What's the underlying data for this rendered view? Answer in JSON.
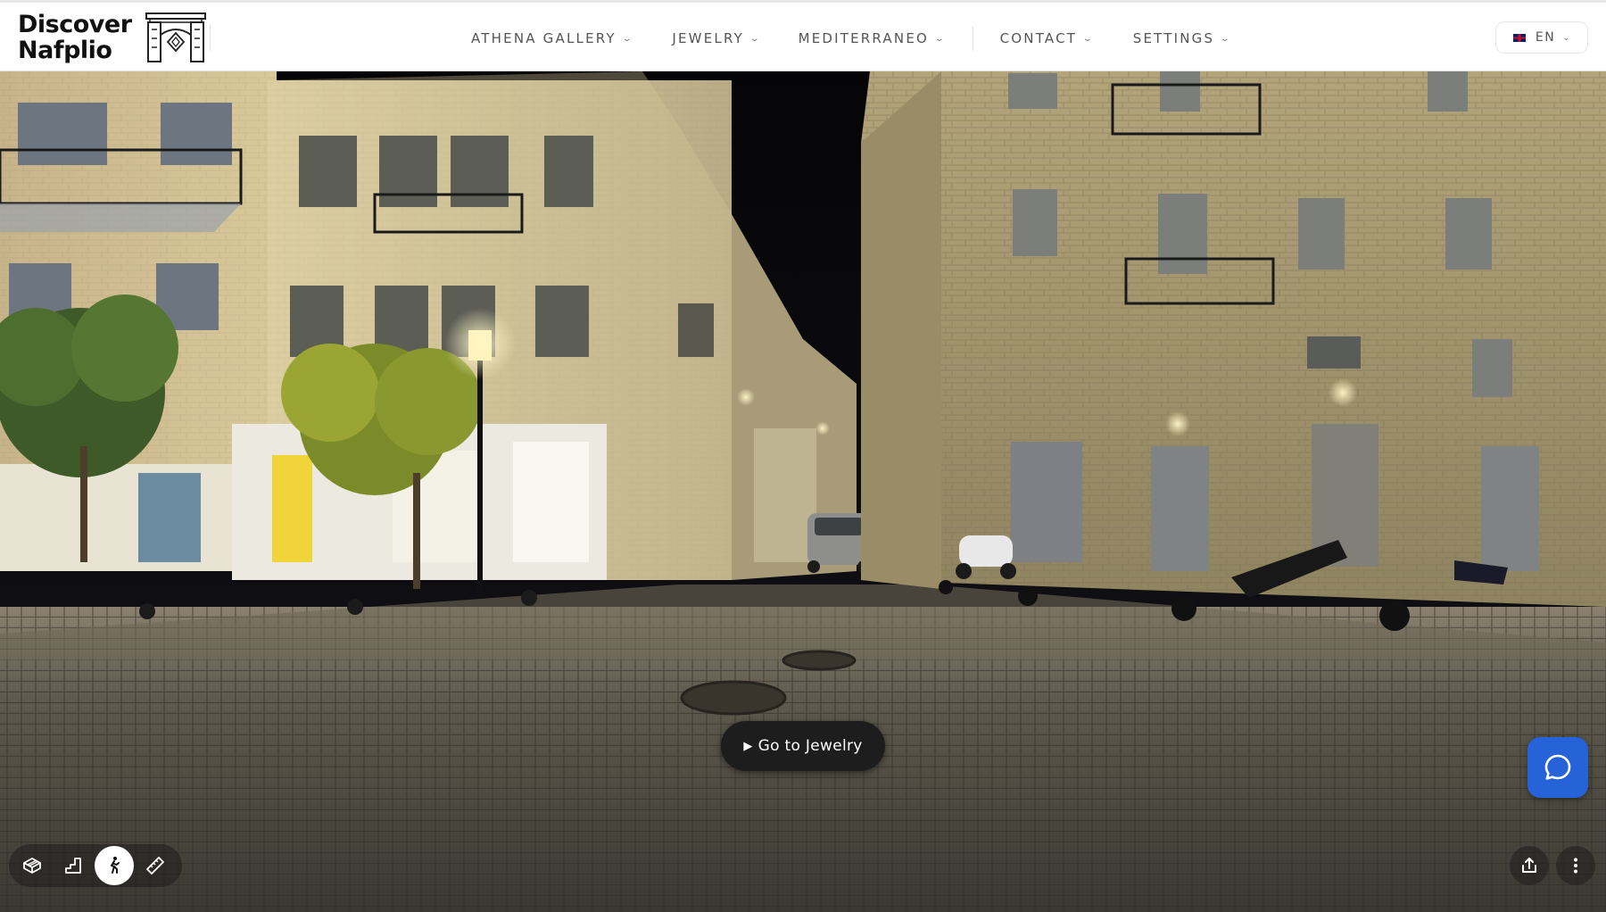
{
  "brand": {
    "line1": "Discover",
    "line2": "Nafplio"
  },
  "nav": {
    "items": [
      {
        "label": "ATHENA GALLERY"
      },
      {
        "label": "JEWELRY"
      },
      {
        "label": "MEDITERRANEO"
      },
      {
        "label": "CONTACT"
      },
      {
        "label": "SETTINGS"
      }
    ]
  },
  "language": {
    "code": "EN",
    "flag_icon": "uk-flag-icon"
  },
  "hotspot": {
    "label": "Go to Jewelry",
    "icon": "play-icon"
  },
  "toolbar": {
    "modes": [
      {
        "name": "dollhouse-view",
        "icon": "dollhouse-icon",
        "active": false
      },
      {
        "name": "floorplan-view",
        "icon": "floorplan-icon",
        "active": false
      },
      {
        "name": "inside-view",
        "icon": "walk-icon",
        "active": true
      },
      {
        "name": "measure",
        "icon": "ruler-icon",
        "active": false
      }
    ],
    "share_icon": "share-icon",
    "more_icon": "more-vertical-icon"
  },
  "chat": {
    "icon": "chat-bubble-icon",
    "color": "#2663d9"
  },
  "colors": {
    "header_bg": "#ffffff",
    "nav_text": "#555555",
    "hotspot_bg": "#1d1d1d"
  }
}
